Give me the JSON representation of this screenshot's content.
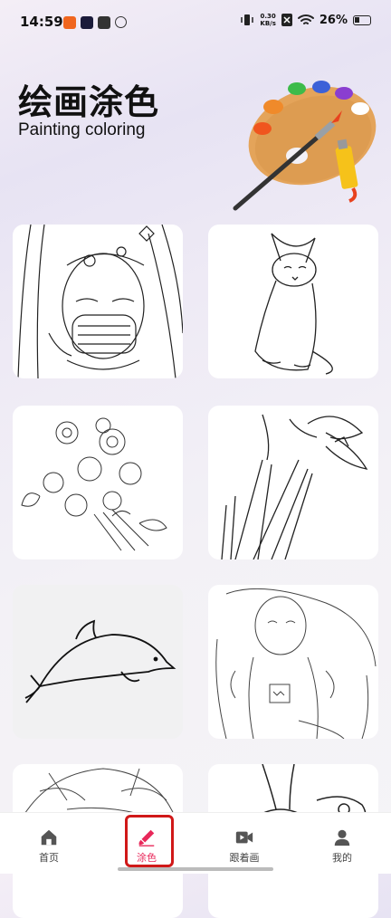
{
  "status_bar": {
    "time": "14:59",
    "net_speed_value": "0.30",
    "net_speed_unit": "KB/s",
    "battery": "26%"
  },
  "header": {
    "title_cn": "绘画涂色",
    "title_en": "Painting coloring"
  },
  "gallery": {
    "items": [
      {
        "subject": "girl-with-mask"
      },
      {
        "subject": "cat"
      },
      {
        "subject": "flower-bouquet"
      },
      {
        "subject": "lily"
      },
      {
        "subject": "dolphin"
      },
      {
        "subject": "anime-girl"
      },
      {
        "subject": "girl-portrait"
      },
      {
        "subject": "rabbit"
      }
    ]
  },
  "tab_bar": {
    "tabs": [
      {
        "label": "首页",
        "icon": "home-icon",
        "active": false
      },
      {
        "label": "涂色",
        "icon": "brush-icon",
        "active": true
      },
      {
        "label": "跟着画",
        "icon": "video-icon",
        "active": false
      },
      {
        "label": "我的",
        "icon": "user-icon",
        "active": false
      }
    ]
  },
  "colors": {
    "accent": "#e8285a",
    "highlight_border": "#d01818"
  }
}
